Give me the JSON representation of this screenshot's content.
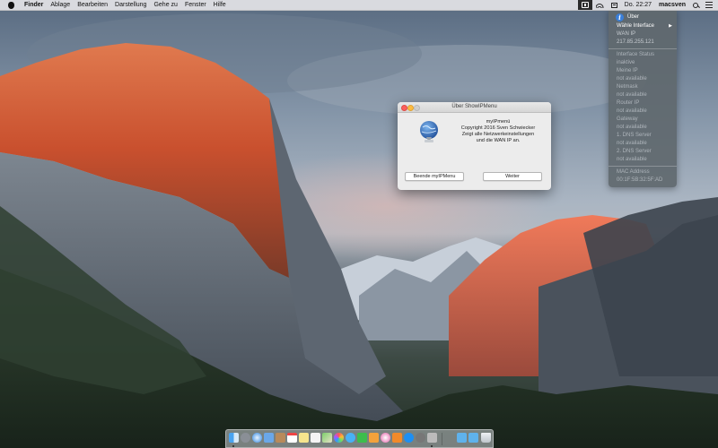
{
  "menubar": {
    "app_name": "Finder",
    "items": [
      "Ablage",
      "Bearbeiten",
      "Darstellung",
      "Gehe zu",
      "Fenster",
      "Hilfe"
    ],
    "clock": "Do. 22:27",
    "user": "macsven",
    "icons": [
      "apple-icon",
      "network-status-icon",
      "wifi-icon",
      "input-source-icon",
      "spotlight-icon",
      "notification-center-icon"
    ]
  },
  "status_menu": {
    "about_label": "Über",
    "select_interface_label": "Wähle Interface",
    "wan_ip_label": "WAN IP",
    "wan_ip_value": "217.85.255.121",
    "interface_status_label": "Interface Status",
    "interface_status_value": "inaktive",
    "my_ip_label": "Meine IP",
    "my_ip_value": "not available",
    "netmask_label": "Netmask",
    "netmask_value": "not available",
    "router_ip_label": "Router IP",
    "router_ip_value": "not available",
    "gateway_label": "Gateway",
    "gateway_value": "not available",
    "dns1_label": "1. DNS Server",
    "dns1_value": "not available",
    "dns2_label": "2. DNS Server",
    "dns2_value": "not available",
    "mac_label": "MAC Address",
    "mac_value": "00:1F:5B:32:5F:AD"
  },
  "about_window": {
    "title": "Über ShowIPMenu",
    "app_name": "myIPmenü",
    "copyright": "Copyright 2016 Sven Schwiecker",
    "description_line1": "Zeigt alle Netzwerkeinstellungen",
    "description_line2": "und die WAN IP an.",
    "quit_button": "Beende myIPMenu",
    "next_button": "Weiter"
  },
  "colors": {
    "menu_background": "#60686e",
    "info_icon": "#3a7fd8",
    "close_button": "#fc605c",
    "minimize_button": "#fdbc40"
  }
}
